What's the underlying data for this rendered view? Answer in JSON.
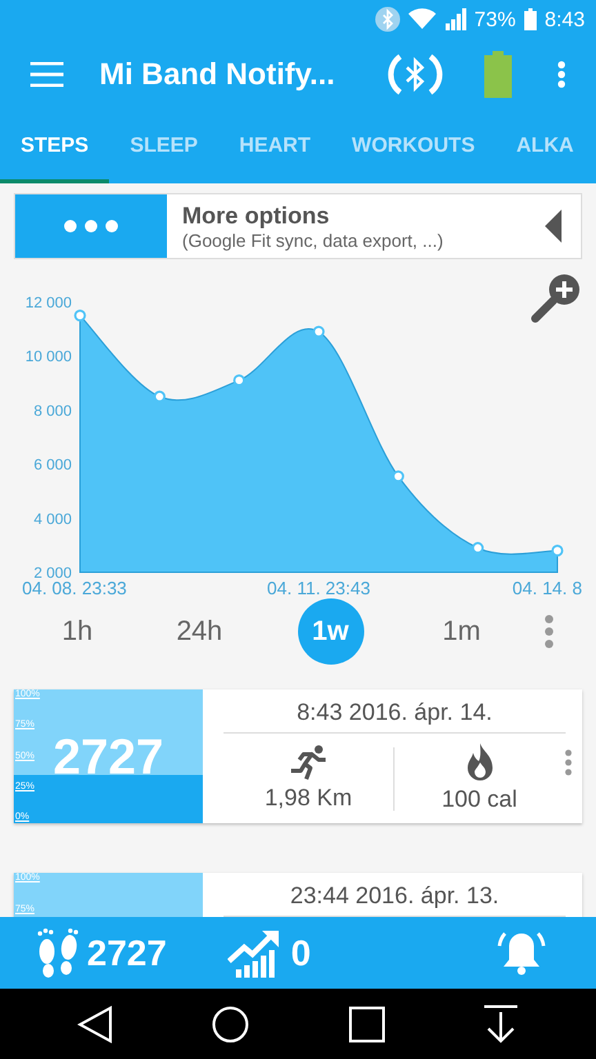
{
  "status_bar": {
    "battery": "73%",
    "time": "8:43"
  },
  "app_bar": {
    "title": "Mi Band Notify..."
  },
  "tabs": [
    {
      "label": "STEPS",
      "selected": true
    },
    {
      "label": "SLEEP",
      "selected": false
    },
    {
      "label": "HEART",
      "selected": false
    },
    {
      "label": "WORKOUTS",
      "selected": false
    },
    {
      "label": "ALKA",
      "selected": false
    }
  ],
  "more_options": {
    "title": "More options",
    "subtitle": "(Google Fit sync, data export, ...)"
  },
  "chart": {
    "chart_data": {
      "type": "area",
      "categories": [
        "04. 08. 23:33",
        null,
        null,
        "04. 11. 23:43",
        null,
        null,
        "04. 14. 8"
      ],
      "series": [
        {
          "color": "#4fc3f7",
          "values": [
            11500,
            8500,
            9100,
            10900,
            5550,
            2900,
            2800
          ]
        }
      ],
      "ylim": [
        2000,
        12000
      ],
      "yticks": [
        {
          "value": 2000,
          "label": "2 000"
        },
        {
          "value": 4000,
          "label": "4 000"
        },
        {
          "value": 6000,
          "label": "6 000"
        },
        {
          "value": 8000,
          "label": "8 000"
        },
        {
          "value": 10000,
          "label": "10 000"
        },
        {
          "value": 12000,
          "label": "12 000"
        }
      ]
    }
  },
  "ranges": [
    {
      "label": "1h",
      "selected": false
    },
    {
      "label": "24h",
      "selected": false
    },
    {
      "label": "1w",
      "selected": true
    },
    {
      "label": "1m",
      "selected": false
    }
  ],
  "day_cards": [
    {
      "steps": "2727",
      "scale": [
        "100%",
        "75%",
        "50%",
        "25%",
        "0%"
      ],
      "date": "8:43 2016. ápr. 14.",
      "distance": "1,98 Km",
      "calories": "100 cal"
    },
    {
      "scale": [
        "100%",
        "75%"
      ],
      "date": "23:44 2016. ápr. 13."
    }
  ],
  "bottom_bar": {
    "steps": "2727",
    "goal": "0"
  }
}
